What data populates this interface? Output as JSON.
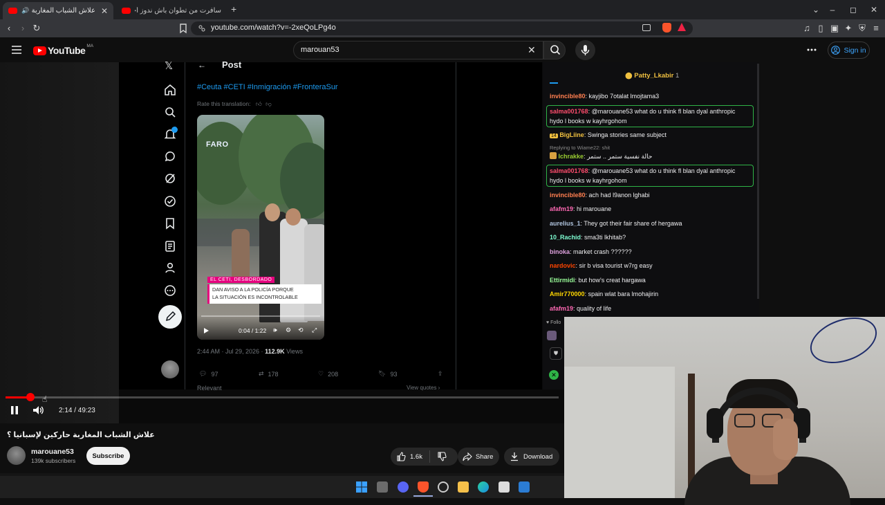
{
  "browser": {
    "tabs": [
      {
        "title": "علاش الشباب المغاربة حاركين إ"
      },
      {
        "title": "سافرت من تطوان باش ندوز أحسن عطلة"
      }
    ],
    "new_tab": "+",
    "url": "youtube.com/watch?v=-2xeQoLPg4o"
  },
  "youtube": {
    "logo_text": "YouTube",
    "country_code": "MA",
    "search_value": "marouan53",
    "signin_label": "Sign in"
  },
  "twitter_post": {
    "title": "Post",
    "hashtags": "#Ceuta #CETI #Inmigración #FronteraSur",
    "rate_translation": "Rate this translation:",
    "video_watermark": "FARO",
    "video_tag": "EL CETI, DESBORDADO",
    "video_caption_line1": "DAN AVISO A LA POLICÍA PORQUE",
    "video_caption_line2": "LA SITUACIÓN ES INCONTROLABLE",
    "video_time": "0:04 / 1:22",
    "posted_at": "2:44 AM · Jul 29, 2026 · ",
    "views_count": "112.9K",
    "views_label": " Views",
    "replies": "97",
    "reposts": "178",
    "likes": "208",
    "bookmarks": "93",
    "relevant": "Relevant",
    "view_quotes": "View quotes ›"
  },
  "chat": {
    "top_user": "Patty_Lkabir",
    "top_count": "1",
    "messages": [
      {
        "user": "invincible80",
        "text": "kayjibo 7otalat lmojtama3",
        "color": "#ff7f50"
      },
      {
        "user": "salma001768",
        "text": "@marouane53 what do u think fl blan dyal anthropic hydo l books w kayhrgohom",
        "color": "#ff4d6d",
        "highlight": true
      },
      {
        "user": "BigLiine",
        "text": "Swinga stories same subject",
        "color": "#f0c040",
        "badge": "14"
      },
      {
        "reply_to": "Replying to Wiame22: shit",
        "user": "lchrakke",
        "text": "حالة نفسية ستمر .. ستمر",
        "color": "#9acd32"
      },
      {
        "user": "salma001768",
        "text": "@marouane53 what do u think fl blan dyal anthropic hydo l books w kayhrgohom",
        "color": "#ff4d6d",
        "highlight": true
      },
      {
        "user": "invincible80",
        "text": "ach had l9anon lghabi",
        "color": "#ff7f50"
      },
      {
        "user": "afafm19",
        "text": "hi marouane",
        "color": "#ff69b4"
      },
      {
        "user": "aurelius_1",
        "text": "They got their fair share of hergawa",
        "color": "#b0c4de"
      },
      {
        "user": "10_Rachid",
        "text": "sma3ti lkhitab?",
        "color": "#7fffd4"
      },
      {
        "user": "binoka",
        "text": "market crash ??????",
        "color": "#dda0dd"
      },
      {
        "user": "nardovic",
        "text": "sir b visa tourist w7rg easy",
        "color": "#ff4500"
      },
      {
        "user": "Ettirmidi",
        "text": "but how's creat hargawa",
        "color": "#98fb98"
      },
      {
        "user": "Amir770000",
        "text": "spain wlat bara lmohajirin",
        "color": "#ffd700"
      },
      {
        "user": "afafm19",
        "text": "quality of life",
        "color": "#ff69b4"
      }
    ],
    "follow_label": "Follo"
  },
  "player": {
    "progress": 0.0453,
    "time": "2:14 / 49:23"
  },
  "video": {
    "title": "علاش الشباب المغاربة حاركين لإسبانيا ؟",
    "channel": "marouane53",
    "subscribers": "139k subscribers",
    "subscribe_label": "Subscribe",
    "likes": "1.6k",
    "share_label": "Share",
    "download_label": "Download"
  },
  "colors": {
    "youtube_red": "#ff0000",
    "twitter_blue": "#1d9bf0",
    "chat_highlight": "#2fb447"
  }
}
